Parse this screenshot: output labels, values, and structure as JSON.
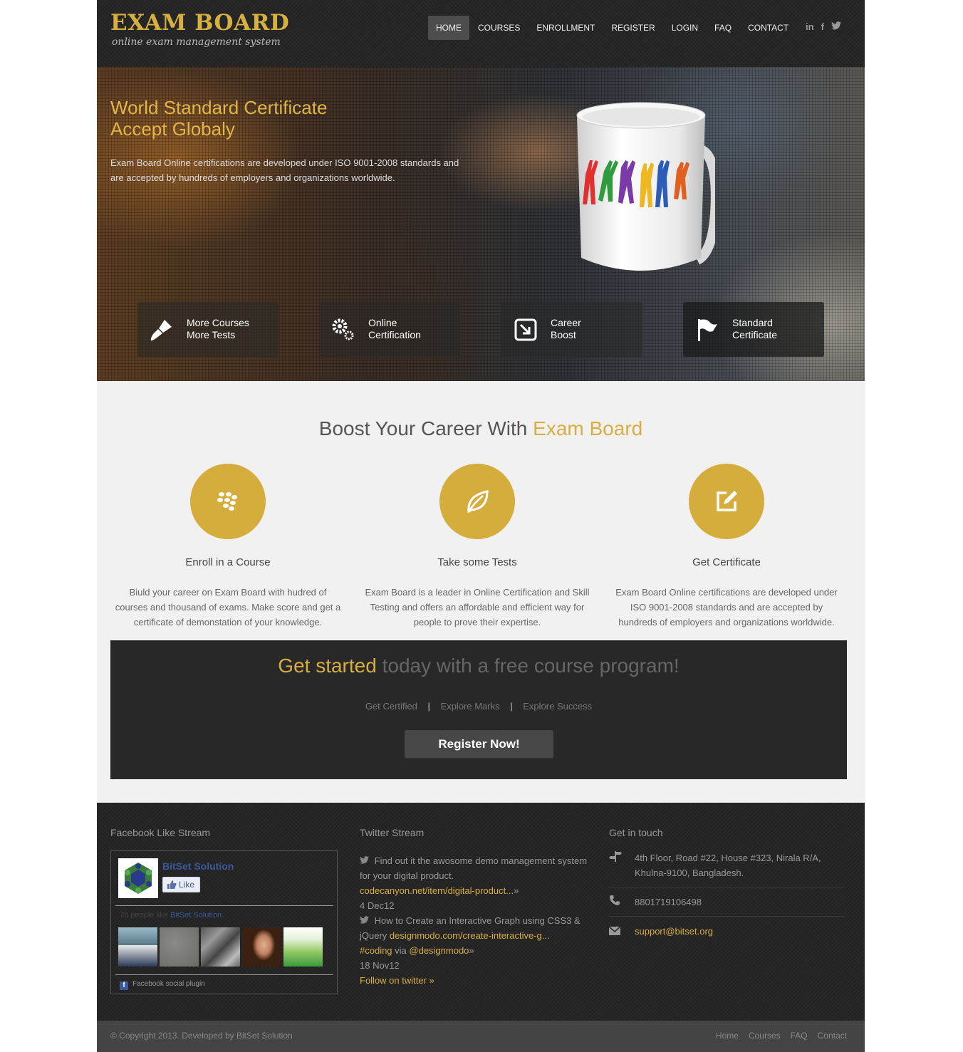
{
  "header": {
    "logo_title": "EXAM BOARD",
    "logo_subtitle": "online exam management system",
    "nav": [
      {
        "label": "HOME",
        "active": true
      },
      {
        "label": "COURSES",
        "active": false
      },
      {
        "label": "ENROLLMENT",
        "active": false
      },
      {
        "label": "REGISTER",
        "active": false
      },
      {
        "label": "LOGIN",
        "active": false
      },
      {
        "label": "FAQ",
        "active": false
      },
      {
        "label": "CONTACT",
        "active": false
      }
    ],
    "social": [
      {
        "icon": "linkedin-icon",
        "glyph": "in"
      },
      {
        "icon": "facebook-icon",
        "glyph": "f"
      },
      {
        "icon": "twitter-icon",
        "glyph": "🐦"
      }
    ]
  },
  "hero": {
    "title_line1": "World Standard Certificate",
    "title_line2": "Accept Globaly",
    "text": "Exam Board Online certifications are developed under ISO 9001-2008 standards and are accepted by hundreds of employers and organizations worldwide.",
    "features": [
      {
        "icon": "brush-icon",
        "line1": "More Courses",
        "line2": "More Tests"
      },
      {
        "icon": "gears-icon",
        "line1": "Online",
        "line2": "Certification"
      },
      {
        "icon": "arrow-box-icon",
        "line1": "Career",
        "line2": "Boost"
      },
      {
        "icon": "flag-icon",
        "line1": "Standard",
        "line2": "Certificate"
      }
    ]
  },
  "boost": {
    "title_prefix": "Boost Your Career With ",
    "title_accent": "Exam Board",
    "columns": [
      {
        "icon": "blackberry-icon",
        "title": "Enroll in a Course",
        "text": "Biuld your career on Exam Board with hudred of courses and thousand of exams. Make score and get a certificate of demonstation of your knowledge."
      },
      {
        "icon": "leaf-icon",
        "title": "Take some Tests",
        "text": "Exam Board is a leader in Online Certification and Skill Testing and offers an affordable and efficient way for people to prove their expertise."
      },
      {
        "icon": "edit-icon",
        "title": "Get Certificate",
        "text": "Exam Board Online certifications are developed under ISO 9001-2008 standards and are accepted by hundreds of employers and organizations worldwide."
      }
    ]
  },
  "cta": {
    "title_accent": "Get started",
    "title_rest": " today with a free course program!",
    "links": [
      "Get Certified",
      "Explore Marks",
      "Explore Success"
    ],
    "separator": "|",
    "button": "Register Now!"
  },
  "footer": {
    "facebook": {
      "heading": "Facebook Like Stream",
      "page_name": "BitSet Solution",
      "like_label": "Like",
      "count_prefix": "76 people like ",
      "count_link": "BitSet Solution",
      "count_suffix": ".",
      "plugin_label": "Facebook social plugin"
    },
    "twitter": {
      "heading": "Twitter Stream",
      "tweet1_text": "Find out it the awosome demo management system for your digital product.",
      "tweet1_link": "codecanyon.net/item/digital-product...",
      "tweet1_arrow": "»",
      "tweet1_date": "4 Dec12",
      "tweet2_text": "How to Create an Interactive Graph using CSS3 & jQuery ",
      "tweet2_link": "designmodo.com/create-interactive-g...",
      "tweet2_tag": "#coding",
      "tweet2_via": " via ",
      "tweet2_handle": "@designmodo",
      "tweet2_arrow": "»",
      "tweet2_date": "18 Nov12",
      "follow": "Follow on twitter »"
    },
    "contact": {
      "heading": "Get in touch",
      "address": "4th Floor, Road #22, House #323, Nirala R/A, Khulna-9100, Bangladesh.",
      "phone": "8801719106498",
      "email": "support@bitset.org"
    }
  },
  "bottom": {
    "copyright": "© Copyright 2013. Developed by BitSet Solution",
    "links": [
      "Home",
      "Courses",
      "FAQ",
      "Contact"
    ]
  },
  "colors": {
    "accent": "#d9ae3f",
    "dark": "#262626",
    "light_bg": "#f1f1f1"
  }
}
